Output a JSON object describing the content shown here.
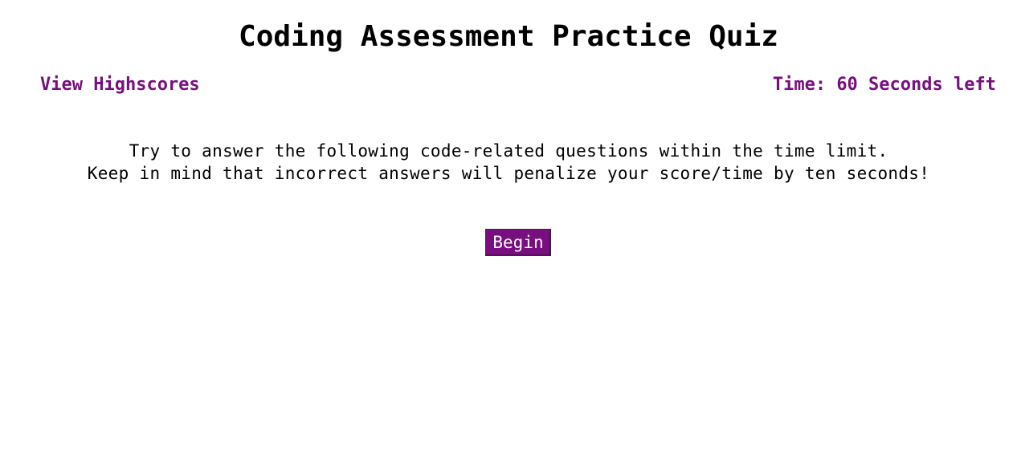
{
  "header": {
    "title": "Coding Assessment Practice Quiz",
    "highscores_link": "View Highscores",
    "timer_text": "Time: 60 Seconds left"
  },
  "intro": {
    "line1": "Try to answer the following code-related questions within the time limit.",
    "line2": "Keep in mind that incorrect answers will penalize your score/time by ten seconds!"
  },
  "actions": {
    "begin_label": "Begin"
  },
  "colors": {
    "accent": "#780e7f",
    "text": "#000000",
    "background": "#ffffff"
  }
}
